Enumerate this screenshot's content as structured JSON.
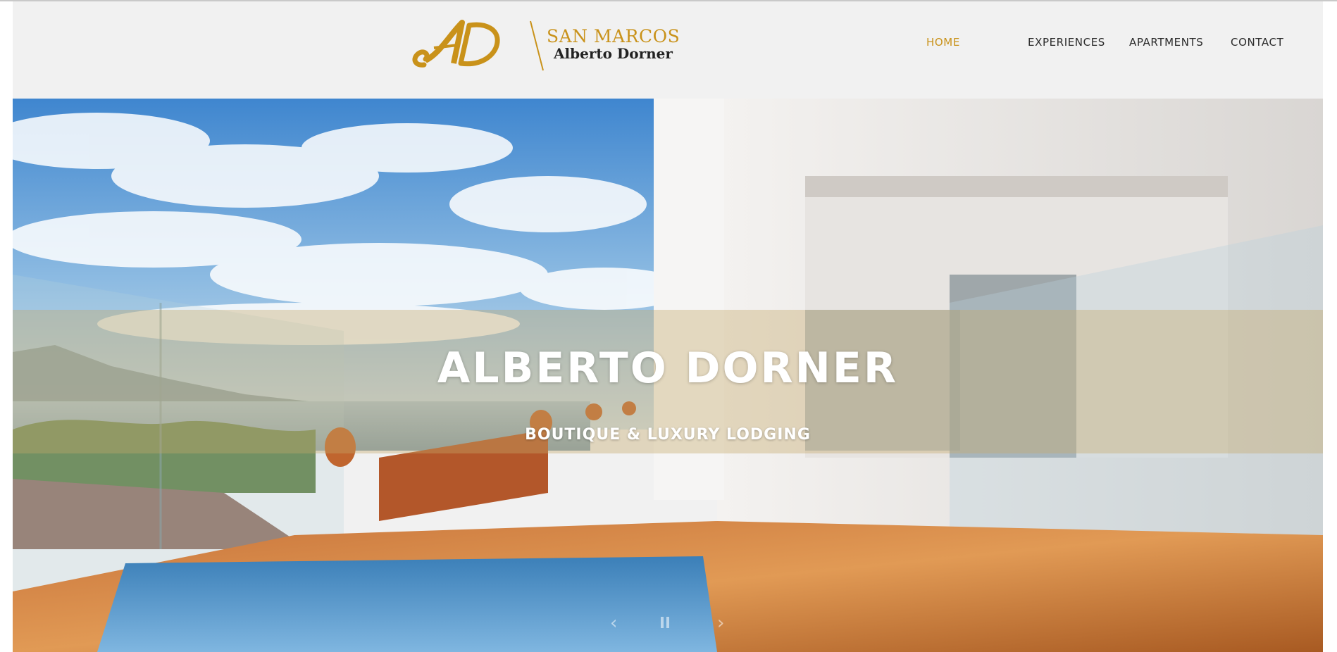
{
  "brand": {
    "monogram": "AD",
    "line1": "SAN MARCOS",
    "line2": "Alberto Dorner"
  },
  "nav": {
    "items": [
      {
        "label": "HOME",
        "active": true
      },
      {
        "label": "EXPERIENCES",
        "active": false
      },
      {
        "label": "APARTMENTS",
        "active": false
      },
      {
        "label": "CONTACT",
        "active": false
      }
    ]
  },
  "hero": {
    "title": "ALBERTO DORNER",
    "subtitle": "BOUTIQUE & LUXURY LODGING"
  },
  "slider": {
    "prev_icon": "chevron-left-icon",
    "pause_icon": "pause-icon",
    "next_icon": "chevron-right-icon"
  },
  "colors": {
    "accent": "#c9921a",
    "background": "#f1f1f1",
    "text": "#2a2a2a",
    "band": "#c4a868"
  }
}
